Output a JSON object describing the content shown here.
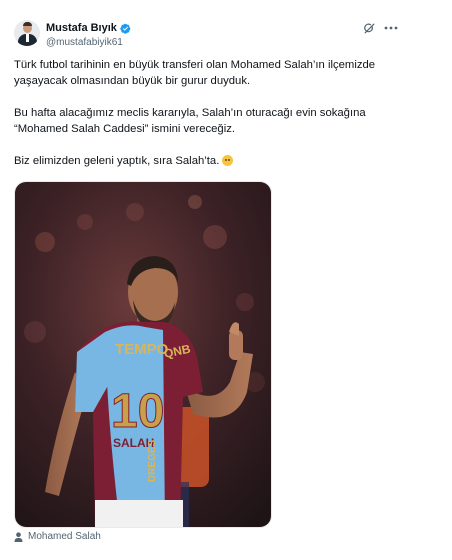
{
  "author": {
    "name": "Mustafa Bıyık",
    "handle": "@mustafabiyik61",
    "verified": true,
    "verified_color": "#1d9bf0"
  },
  "header_icons": [
    "grok-icon",
    "more-icon"
  ],
  "tweet": {
    "paragraphs": [
      "Türk futbol tarihinin en büyük transferi olan Mohamed Salah’ın ilçemizde yaşayacak olmasından büyük bir gurur duyduk.",
      "Bu hafta alacağımız meclis kararıyla, Salah’ın oturacağı evin sokağına “Mohamed Salah Caddesi” ismini vereceğiz.",
      "Biz elimizden geleni yaptık, sıra Salah’ta."
    ],
    "emoji": "smiling-face-emoji"
  },
  "media": {
    "jersey_number": "10",
    "jersey_name": "SALAH",
    "jersey_sponsor": "QNB",
    "jersey_partner": "TEMPO",
    "jersey_side_text": "DREGES",
    "jersey_colors": {
      "claret": "#7c1f34",
      "blue": "#78b7e4"
    }
  },
  "tag": {
    "icon": "person-icon",
    "label": "Mohamed Salah"
  }
}
